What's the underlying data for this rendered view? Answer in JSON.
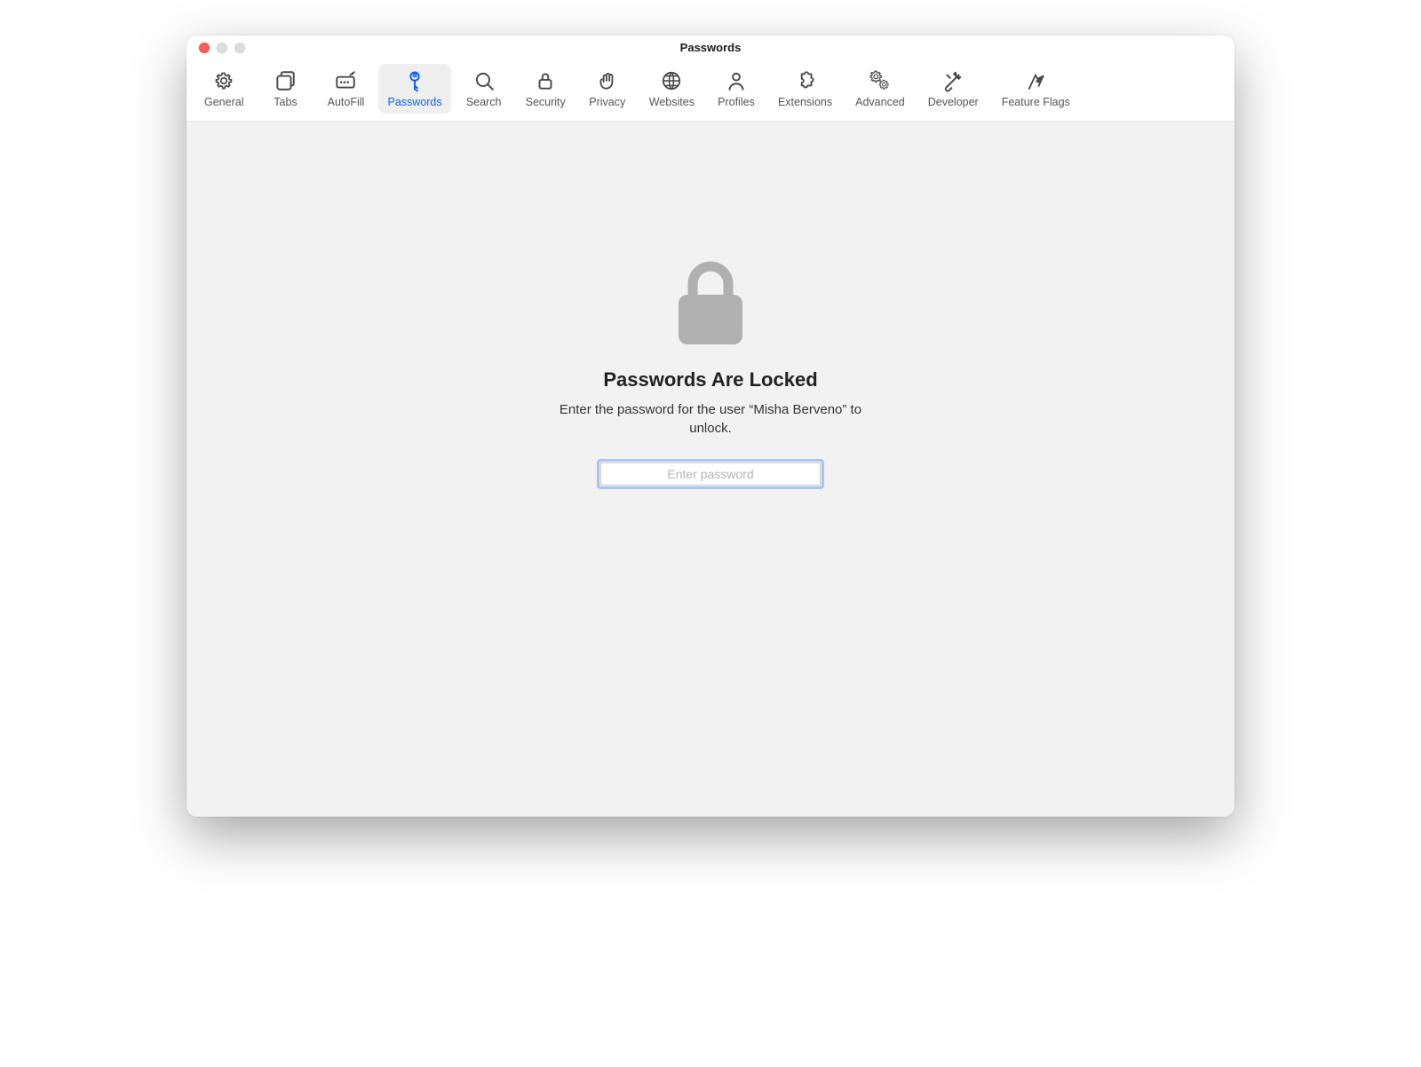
{
  "window": {
    "title": "Passwords"
  },
  "toolbar": {
    "items": [
      {
        "id": "general",
        "label": "General",
        "icon": "gear-icon",
        "active": false
      },
      {
        "id": "tabs",
        "label": "Tabs",
        "icon": "tabs-icon",
        "active": false
      },
      {
        "id": "autofill",
        "label": "AutoFill",
        "icon": "autofill-icon",
        "active": false
      },
      {
        "id": "passwords",
        "label": "Passwords",
        "icon": "key-icon",
        "active": true
      },
      {
        "id": "search",
        "label": "Search",
        "icon": "search-icon",
        "active": false
      },
      {
        "id": "security",
        "label": "Security",
        "icon": "lock-icon",
        "active": false
      },
      {
        "id": "privacy",
        "label": "Privacy",
        "icon": "hand-icon",
        "active": false
      },
      {
        "id": "websites",
        "label": "Websites",
        "icon": "globe-icon",
        "active": false
      },
      {
        "id": "profiles",
        "label": "Profiles",
        "icon": "person-icon",
        "active": false
      },
      {
        "id": "extensions",
        "label": "Extensions",
        "icon": "puzzle-icon",
        "active": false
      },
      {
        "id": "advanced",
        "label": "Advanced",
        "icon": "gears-icon",
        "active": false
      },
      {
        "id": "developer",
        "label": "Developer",
        "icon": "tools-icon",
        "active": false
      },
      {
        "id": "featureflags",
        "label": "Feature Flags",
        "icon": "flags-icon",
        "active": false
      }
    ]
  },
  "main": {
    "heading": "Passwords Are Locked",
    "subtitle": "Enter the password for the user “Misha Berveno” to unlock.",
    "password_placeholder": "Enter password",
    "password_value": ""
  }
}
